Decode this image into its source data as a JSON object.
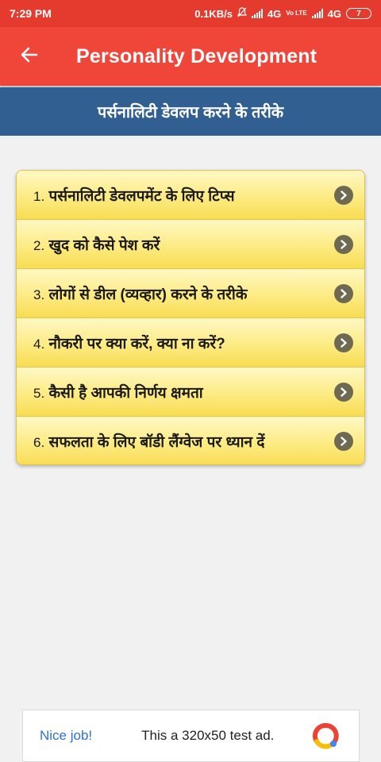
{
  "status_bar": {
    "time": "7:29 PM",
    "net_speed": "0.1KB/s",
    "network1": "4G",
    "volte": "Vo LTE",
    "network2": "4G",
    "battery": "7"
  },
  "app_bar": {
    "title": "Personality Development"
  },
  "section": {
    "title": "पर्सनालिटी डेवलप करने के तरीके"
  },
  "menu": {
    "items": [
      {
        "num": "1.",
        "label": "पर्सनालिटी डेवलपमेंट के लिए टिप्स"
      },
      {
        "num": "2.",
        "label": "खुद को कैसे पेश करें"
      },
      {
        "num": "3.",
        "label": "लोगों से डील (व्यव्हार) करने के तरीके"
      },
      {
        "num": "4.",
        "label": "नौकरी पर क्या करें, क्या ना करें?"
      },
      {
        "num": "5.",
        "label": "कैसी है आपकी निर्णय क्षमता"
      },
      {
        "num": "6.",
        "label": "सफलता के लिए बॉडी लैंग्वेज पर ध्यान दें"
      }
    ]
  },
  "ad": {
    "nice": "Nice job!",
    "text": "This a 320x50 test ad."
  },
  "colors": {
    "status_bar": "#e53b2f",
    "app_bar": "#f0463a",
    "section_header": "#325f91",
    "menu_item": "#fdeb83"
  },
  "icons": {
    "back": "arrow-left-icon",
    "menu_chevron": "chevron-right-circle-icon",
    "ad_logo": "ad-logo-icon"
  }
}
